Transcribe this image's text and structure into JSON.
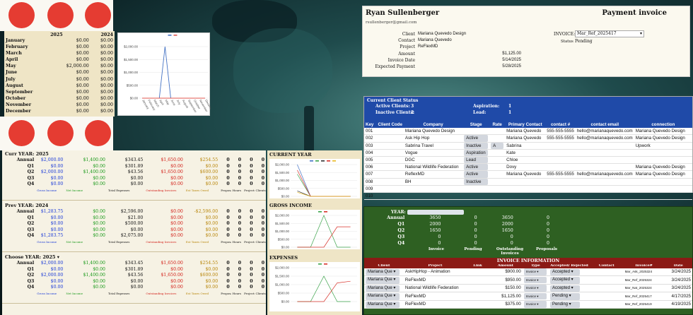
{
  "months": {
    "header": [
      "2025",
      "2024"
    ],
    "rows": [
      {
        "m": "January",
        "a": "$0.00",
        "b": "$0.00"
      },
      {
        "m": "February",
        "a": "$0.00",
        "b": "$0.00"
      },
      {
        "m": "March",
        "a": "$0.00",
        "b": "$0.00"
      },
      {
        "m": "April",
        "a": "$0.00",
        "b": "$0.00"
      },
      {
        "m": "May",
        "a": "$2,000.00",
        "b": "$0.00"
      },
      {
        "m": "June",
        "a": "$0.00",
        "b": "$0.00"
      },
      {
        "m": "July",
        "a": "$0.00",
        "b": "$0.00"
      },
      {
        "m": "August",
        "a": "$0.00",
        "b": "$0.00"
      },
      {
        "m": "September",
        "a": "$0.00",
        "b": "$0.00"
      },
      {
        "m": "October",
        "a": "$0.00",
        "b": "$0.00"
      },
      {
        "m": "November",
        "a": "$0.00",
        "b": "$0.00"
      },
      {
        "m": "December",
        "a": "$0.00",
        "b": "$0.00"
      }
    ]
  },
  "chart_data": [
    {
      "type": "line",
      "categories": [
        "January",
        "February",
        "March",
        "April",
        "May",
        "June",
        "July",
        "August",
        "September",
        "October",
        "November",
        "December"
      ],
      "series": [
        {
          "values": [
            0,
            0,
            0,
            0,
            2000,
            0,
            0,
            0,
            0,
            0,
            0,
            0
          ],
          "color": "#4472c4"
        },
        {
          "values": [
            0,
            0,
            0,
            0,
            0,
            0,
            0,
            0,
            0,
            0,
            0,
            0
          ],
          "color": "#e0574f"
        }
      ],
      "yticks": [
        "$2,000.00",
        "$1,500.00",
        "$1,000.00",
        "$500.00",
        "$0.00"
      ],
      "ylim": [
        0,
        2000
      ]
    },
    {
      "type": "line",
      "title": "CURRENT YEAR",
      "categories": [
        "Annual",
        "Q1",
        "Q2",
        "Q3",
        "Q4"
      ],
      "series": [
        {
          "values": [
            2000,
            0,
            0,
            0,
            0
          ],
          "color": "#4472c4"
        },
        {
          "values": [
            1400,
            0,
            0,
            0,
            0
          ],
          "color": "#3aa34a"
        },
        {
          "values": [
            343,
            0,
            0,
            0,
            0
          ],
          "color": "#333333"
        },
        {
          "values": [
            1650,
            0,
            0,
            0,
            0
          ],
          "color": "#d8312a"
        },
        {
          "values": [
            254,
            0,
            0,
            0,
            0
          ],
          "color": "#e8b923"
        }
      ],
      "yticks": [
        "$2,000.00",
        "$1,500.00",
        "$1,000.00",
        "$500.00",
        "$0.00"
      ],
      "ylim": [
        0,
        2000
      ]
    },
    {
      "type": "line",
      "title": "GROSS INCOME",
      "categories": [
        "Annual",
        "Q1",
        "Q2",
        "Q3",
        "Q4"
      ],
      "series": [
        {
          "values": [
            0,
            0,
            2000,
            0,
            0
          ],
          "color": "#3aa34a"
        },
        {
          "values": [
            0,
            0,
            0,
            1283,
            1283
          ],
          "color": "#d8312a"
        }
      ],
      "yticks": [
        "$2,000.00",
        "$1,500.00",
        "$1,000.00",
        "$500.00",
        "$0.00"
      ],
      "ylim": [
        0,
        2000
      ]
    },
    {
      "type": "line",
      "title": "EXPENSES",
      "categories": [
        "Annual",
        "Q1",
        "Q2",
        "Q3",
        "Q4"
      ],
      "series": [
        {
          "values": [
            0,
            0,
            1500,
            0,
            0
          ],
          "color": "#3aa34a"
        },
        {
          "values": [
            0,
            0,
            0,
            1100,
            1200
          ],
          "color": "#d8312a"
        }
      ],
      "yticks": [
        "$2,000.00",
        "$1,500.00",
        "$1,000.00",
        "$500.00",
        "$0.00"
      ],
      "ylim": [
        0,
        2000
      ]
    }
  ],
  "summary": {
    "foot": [
      "Gross Income",
      "Net Income",
      "Total Expenses",
      "Outstanding Invoices",
      "Est Taxes Owed",
      "Proposals",
      "Hours",
      "Projects",
      "Clients"
    ],
    "blocks": [
      {
        "label": "Curr YEAR:",
        "year": "2025",
        "rows": [
          {
            "k": "Annual",
            "v": [
              "$2,000.00",
              "$1,400.00",
              "$343.45",
              "$1,650.00",
              "$254.55",
              "0",
              "0",
              "0",
              "0"
            ]
          },
          {
            "k": "Q1",
            "v": [
              "$0.00",
              "$0.00",
              "$301.89",
              "$0.00",
              "$0.00",
              "0",
              "0",
              "0",
              "0"
            ]
          },
          {
            "k": "Q2",
            "v": [
              "$2,000.00",
              "$1,400.00",
              "$43.56",
              "$1,650.00",
              "$600.00",
              "0",
              "0",
              "0",
              "0"
            ]
          },
          {
            "k": "Q3",
            "v": [
              "$0.00",
              "$0.00",
              "$0.00",
              "$0.00",
              "$0.00",
              "0",
              "0",
              "0",
              "0"
            ]
          },
          {
            "k": "Q4",
            "v": [
              "$0.00",
              "$0.00",
              "$0.00",
              "$0.00",
              "$0.00",
              "0",
              "0",
              "0",
              "0"
            ]
          }
        ]
      },
      {
        "label": "Prev YEAR:",
        "year": "2024",
        "rows": [
          {
            "k": "Annual",
            "v": [
              "$1,283.75",
              "$0.00",
              "$2,596.00",
              "$0.00",
              "-$2,596.00",
              "0",
              "0",
              "0",
              "0"
            ]
          },
          {
            "k": "Q1",
            "v": [
              "$0.00",
              "$0.00",
              "$21.00",
              "$0.00",
              "$0.00",
              "0",
              "0",
              "0",
              "0"
            ]
          },
          {
            "k": "Q2",
            "v": [
              "$0.00",
              "$0.00",
              "$500.00",
              "$0.00",
              "$0.00",
              "0",
              "0",
              "0",
              "0"
            ]
          },
          {
            "k": "Q3",
            "v": [
              "$0.00",
              "$0.00",
              "$0.00",
              "$0.00",
              "$0.00",
              "0",
              "0",
              "0",
              "0"
            ]
          },
          {
            "k": "Q4",
            "v": [
              "$1,283.75",
              "$0.00",
              "$2,075.00",
              "$0.00",
              "$0.00",
              "0",
              "0",
              "0",
              "0"
            ]
          }
        ]
      },
      {
        "label": "Choose YEAR:",
        "year": "2025",
        "rows": [
          {
            "k": "Annual",
            "v": [
              "$2,000.00",
              "$1,400.00",
              "$343.45",
              "$1,650.00",
              "$254.55",
              "0",
              "0",
              "0",
              "0"
            ]
          },
          {
            "k": "Q1",
            "v": [
              "$0.00",
              "$0.00",
              "$301.89",
              "$0.00",
              "$0.00",
              "0",
              "0",
              "0",
              "0"
            ]
          },
          {
            "k": "Q2",
            "v": [
              "$2,000.00",
              "$1,400.00",
              "$43.56",
              "$1,650.00",
              "$600.00",
              "0",
              "0",
              "0",
              "0"
            ]
          },
          {
            "k": "Q3",
            "v": [
              "$0.00",
              "$0.00",
              "$0.00",
              "$0.00",
              "$0.00",
              "0",
              "0",
              "0",
              "0"
            ]
          },
          {
            "k": "Q4",
            "v": [
              "$0.00",
              "$0.00",
              "$0.00",
              "$0.00",
              "$0.00",
              "0",
              "0",
              "0",
              "0"
            ]
          }
        ]
      }
    ]
  },
  "invoice_card": {
    "name": "Ryan Sullenberger",
    "title": "Payment invoice",
    "email": "rsullenberger@gmail.com",
    "fields": [
      {
        "k": "Client",
        "v": "Mariana Quevedo Design"
      },
      {
        "k": "Contact",
        "v": "Mariana Quevedo"
      },
      {
        "k": "Project",
        "v": "ReFlexMD"
      },
      {
        "k": "Amount",
        "v": "$1,125.00"
      },
      {
        "k": "Invoice Date",
        "v": "5/14/2025"
      },
      {
        "k": "Expected Payment",
        "v": "5/28/2025"
      }
    ],
    "invoice_label": "INVOICE:",
    "invoice_value": "Mar_Ref_2025417",
    "status_label": "Status",
    "status_value": "Pending"
  },
  "clients": {
    "status_title": "Current Client Status",
    "stats": [
      {
        "k": "Active Clients:",
        "v": "3"
      },
      {
        "k": "Inactive Clients:",
        "v": "2"
      },
      {
        "k": "Aspiration:",
        "v": "1"
      },
      {
        "k": "Lead:",
        "v": "1"
      }
    ],
    "headers": [
      "Key",
      "Client Code",
      "Company",
      "Stage",
      "Rate",
      "Primary Contact",
      "contact #",
      "contact email",
      "connection"
    ],
    "rows": [
      [
        "001",
        "",
        "Mariana Quevedo Design",
        "",
        "",
        "Mariana Quevedo",
        "555-555-5555",
        "hello@marianaquevedo.com",
        "Mariana Quevedo Design"
      ],
      [
        "002",
        "",
        "Ask Hip Hop",
        "Active",
        "",
        "Mariana Quevedo",
        "555-555-5555",
        "hello@marianaquevedo.com",
        "Mariana Quevedo Design"
      ],
      [
        "003",
        "",
        "Sabrina Travel",
        "Inactive",
        "A",
        "Sabrina",
        "",
        "",
        "Upwork"
      ],
      [
        "004",
        "",
        "Vogue",
        "Aspiration",
        "",
        "Kate",
        "",
        "",
        ""
      ],
      [
        "005",
        "",
        "DGC",
        "Lead",
        "",
        "Chloe",
        "",
        "",
        ""
      ],
      [
        "006",
        "",
        "National Wildlife Federation",
        "Active",
        "",
        "Dovy",
        "",
        "",
        "Mariana Quevedo Design"
      ],
      [
        "007",
        "",
        "ReflexMD",
        "Active",
        "",
        "Mariana Quevedo",
        "555-555-5555",
        "hello@marianaquevedo.com",
        "Mariana Quevedo Design"
      ],
      [
        "008",
        "",
        "BH",
        "Inactive",
        "",
        "",
        "",
        "",
        ""
      ],
      [
        "009",
        "",
        "",
        "",
        "",
        "",
        "",
        "",
        ""
      ],
      [
        "010",
        "",
        "",
        "",
        "",
        "",
        "",
        "",
        ""
      ]
    ]
  },
  "invoices": {
    "year_label": "YEAR:",
    "rows": [
      {
        "k": "Annual",
        "v": [
          "3650",
          "0",
          "3650",
          "0"
        ]
      },
      {
        "k": "Q1",
        "v": [
          "2000",
          "0",
          "2000",
          "0"
        ]
      },
      {
        "k": "Q2",
        "v": [
          "1650",
          "0",
          "1650",
          "0"
        ]
      },
      {
        "k": "Q3",
        "v": [
          "0",
          "0",
          "0",
          "0"
        ]
      },
      {
        "k": "Q4",
        "v": [
          "0",
          "0",
          "0",
          "0"
        ]
      }
    ],
    "foot": [
      "Invoice",
      "Pending",
      "Outstanding Invoices",
      "Proposals"
    ],
    "info_title": "INVOICE INFORMATION",
    "headers": [
      "Client",
      "Project",
      "Link",
      "Amount",
      "Type",
      "Accepted/ Rejected",
      "Contact",
      "Invoice#",
      "Date"
    ],
    "list": [
      [
        "Mariana Que",
        "AskHipHop - Animation",
        "",
        "$900.00",
        "Invoice",
        "Accepted",
        "",
        "Mar_Ask_2025324",
        "3/24/2025"
      ],
      [
        "Mariana Que",
        "ReFlexMD",
        "",
        "$950.00",
        "Invoice",
        "Accepted",
        "",
        "Mar_Ref_2025324",
        "3/24/2025"
      ],
      [
        "Mariana Que",
        "National Wildlife Federation",
        "",
        "$150.00",
        "Invoice",
        "Accepted",
        "",
        "Mar_Nat_2025324",
        "3/24/2025"
      ],
      [
        "Mariana Que",
        "ReFlexMD",
        "",
        "$1,125.00",
        "Invoice",
        "Pending",
        "",
        "Mar_Ref_2025417",
        "4/17/2025"
      ],
      [
        "Mariana Que",
        "ReFlexMD",
        "",
        "$375.00",
        "Invoice",
        "Pending",
        "",
        "Mar_Ref_2025419",
        "4/19/2025"
      ]
    ]
  }
}
